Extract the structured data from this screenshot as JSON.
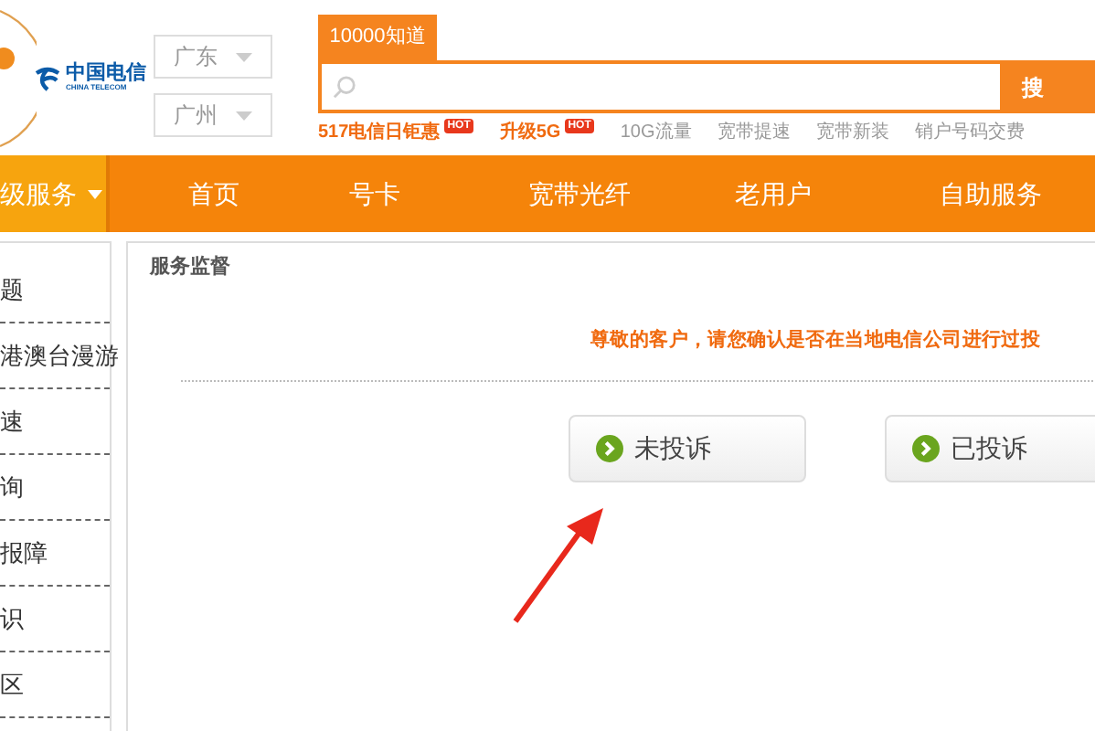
{
  "logo": {
    "name": "中国电信",
    "subname": "CHINA TELECOM"
  },
  "region_selects": [
    {
      "value": "广东"
    },
    {
      "value": "广州"
    }
  ],
  "search": {
    "tab": "10000知道",
    "button": "搜"
  },
  "hot_links": [
    {
      "label": "517电信日钜惠",
      "hot": true,
      "badge": "HOT"
    },
    {
      "label": "升级5G",
      "hot": true,
      "badge": "HOT"
    },
    {
      "label": "10G流量",
      "hot": false
    },
    {
      "label": "宽带提速",
      "hot": false
    },
    {
      "label": "宽带新装",
      "hot": false
    },
    {
      "label": "销户号码交费",
      "hot": false
    }
  ],
  "nav": {
    "menu": "级服务",
    "items": [
      {
        "label": "首页"
      },
      {
        "label": "号卡"
      },
      {
        "label": "宽带光纤"
      },
      {
        "label": "老用户"
      },
      {
        "label": "自助服务"
      }
    ]
  },
  "sidebar": {
    "items": [
      "题",
      "港澳台漫游",
      "速",
      "询",
      "报障",
      "识",
      "区"
    ]
  },
  "panel": {
    "title": "服务监督",
    "notice": "尊敬的客户，请您确认是否在当地电信公司进行过投",
    "buttons": [
      {
        "label": "未投诉"
      },
      {
        "label": "已投诉"
      }
    ]
  }
}
